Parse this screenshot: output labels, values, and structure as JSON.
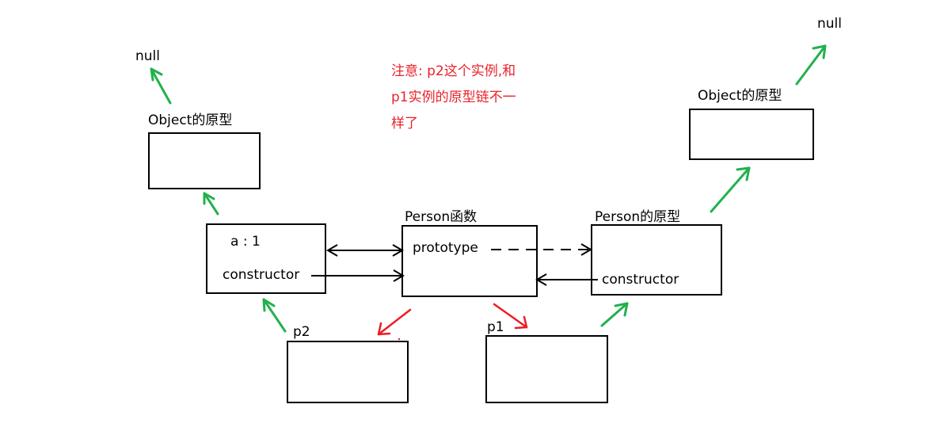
{
  "labels": {
    "null_left": "null",
    "null_right": "null",
    "object_proto_left": "Object的原型",
    "object_proto_right": "Object的原型",
    "person_func": "Person函数",
    "person_proto": "Person的原型",
    "p2_a": "a : 1",
    "p2_constructor": "constructor",
    "prototype": "prototype",
    "constructor_right": "constructor",
    "p2": "p2",
    "p1": "p1"
  },
  "note": {
    "line1": "注意: p2这个实例,和",
    "line2": "p1实例的原型链不一",
    "line3": "样了"
  },
  "colors": {
    "line": "#000000",
    "green_arrow": "#22b14c",
    "red_arrow": "#ed1c24",
    "note_text": "#e8232b"
  }
}
